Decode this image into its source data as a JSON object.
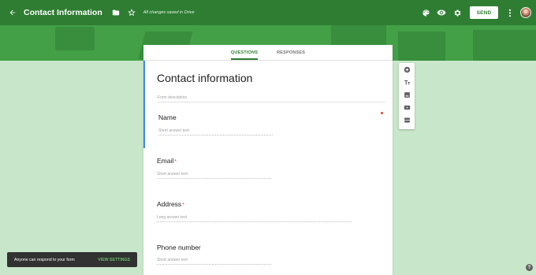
{
  "header": {
    "title": "Contact Information",
    "saved_status": "All changes saved in Drive",
    "send_label": "SEND"
  },
  "tabs": [
    {
      "label": "QUESTIONS",
      "active": true
    },
    {
      "label": "RESPONSES",
      "active": false
    }
  ],
  "form": {
    "title": "Contact information",
    "description_placeholder": "Form description",
    "questions": [
      {
        "title": "Name",
        "required_marker": "",
        "placeholder": "Short answer text"
      },
      {
        "title": "Email",
        "required_marker": "*",
        "placeholder": "Short answer text"
      },
      {
        "title": "Address",
        "required_marker": "*",
        "placeholder": "Long answer text"
      },
      {
        "title": "Phone number",
        "required_marker": "",
        "placeholder": "Short answer text"
      }
    ],
    "required_dot": "*"
  },
  "snackbar": {
    "message": "Anyone can respond to your form",
    "action": "VIEW SETTINGS"
  },
  "help_label": "?",
  "icons": {
    "back": "arrow-back-icon",
    "folder": "folder-icon",
    "star": "star-outline-icon",
    "palette": "palette-icon",
    "preview": "eye-icon",
    "settings": "gear-icon",
    "more": "more-vert-icon",
    "sidebar": [
      "add-circle-icon",
      "title-text-icon",
      "image-icon",
      "video-icon",
      "section-icon"
    ]
  },
  "colors": {
    "header": "#2e7d32",
    "banner": "#43a047",
    "page_bg": "#c8e6c9",
    "accent_blue": "#4285f4",
    "required": "#db4437",
    "snackbar_action": "#66bb6a"
  }
}
